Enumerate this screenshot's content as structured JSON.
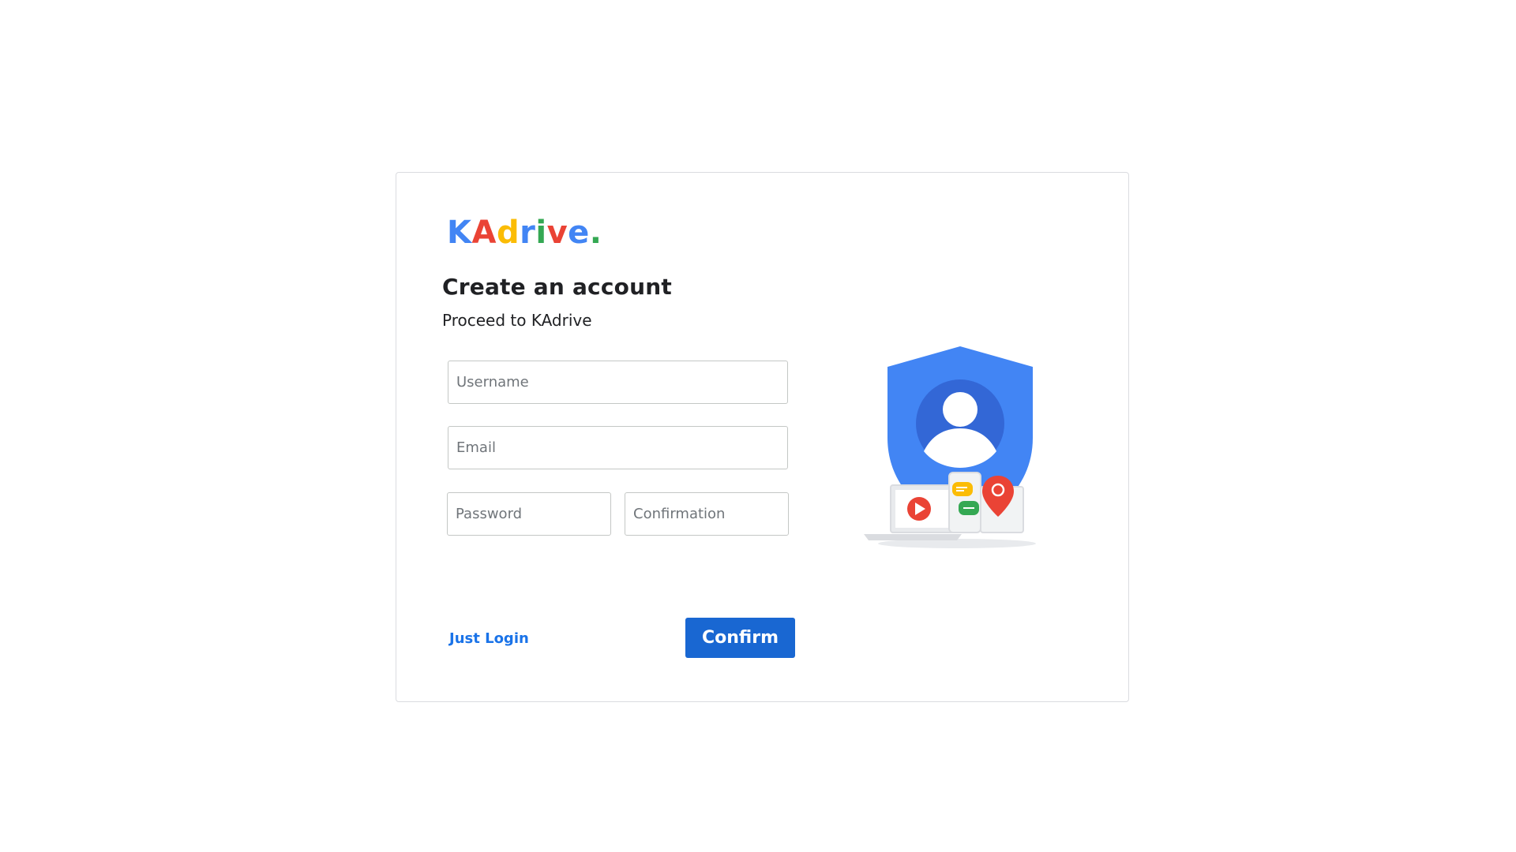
{
  "brand": {
    "letters": [
      {
        "char": "K",
        "color": "#4285f4"
      },
      {
        "char": "A",
        "color": "#ea4335"
      },
      {
        "char": "d",
        "color": "#fbbc05"
      },
      {
        "char": "r",
        "color": "#4285f4"
      },
      {
        "char": "i",
        "color": "#34a853"
      },
      {
        "char": "v",
        "color": "#ea4335"
      },
      {
        "char": "e",
        "color": "#4285f4"
      },
      {
        "char": ".",
        "color": "#34a853"
      }
    ]
  },
  "header": {
    "title": "Create an account",
    "subtitle": "Proceed to KAdrive"
  },
  "form": {
    "username": {
      "placeholder": "Username",
      "value": ""
    },
    "email": {
      "placeholder": "Email",
      "value": ""
    },
    "password": {
      "placeholder": "Password",
      "value": ""
    },
    "confirmation": {
      "placeholder": "Confirmation",
      "value": ""
    }
  },
  "actions": {
    "login_link": "Just Login",
    "confirm_button": "Confirm"
  },
  "colors": {
    "accent": "#1967d2",
    "link": "#1a73e8",
    "shield": "#4285f4",
    "avatar_bg": "#3367d6"
  },
  "illustration": {
    "icons": [
      "account-shield-icon",
      "user-avatar-icon",
      "laptop-icon",
      "play-icon",
      "phone-icon",
      "chat-icon",
      "map-pin-icon"
    ]
  }
}
